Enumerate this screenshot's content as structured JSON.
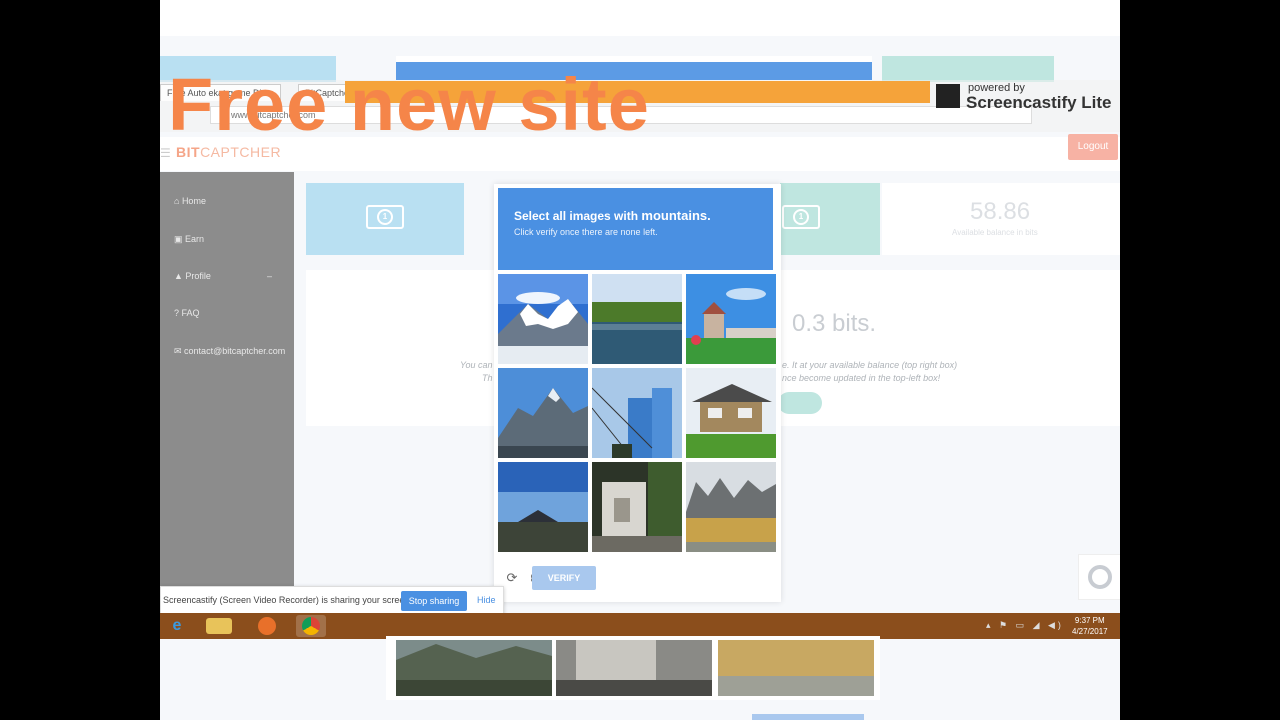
{
  "overlay": {
    "headline": "Free new site",
    "screencastify_powered": "powered by",
    "screencastify_name": "Screencastify Lite"
  },
  "browser": {
    "tabs": [
      "Free Auto ekat game Dic...",
      "BitCaptcher"
    ],
    "address": "www.bitcaptcher.com"
  },
  "site": {
    "brand_prefix": "BIT",
    "brand_suffix": "CAPTCHER",
    "logout_label": "Logout",
    "sidebar": [
      {
        "icon": "home-icon",
        "label": "Home"
      },
      {
        "icon": "earn-icon",
        "label": "Earn"
      },
      {
        "icon": "profile-icon",
        "label": "Profile"
      },
      {
        "icon": "faq-icon",
        "label": "FAQ"
      },
      {
        "icon": "mail-icon",
        "label": "contact@bitcaptcher.com"
      }
    ],
    "balance_value": "58.86",
    "balance_label": "Available balance in bits",
    "reward_text": "0.3 bits.",
    "info_left_1": "You can",
    "info_left_2": "Th",
    "info_right_1": "e. It at your available balance (top right box)",
    "info_right_2": "nce become updated in the top-left box!"
  },
  "captcha": {
    "title_prefix": "Select all images with",
    "title_keyword": "mountains.",
    "subtitle": "Click verify once there are none left.",
    "verify_label": "VERIFY",
    "tiles": [
      "snowy-mountain",
      "lake",
      "temple",
      "rocky-peak",
      "skyscraper",
      "house",
      "volcano-horizon",
      "stone-hut",
      "rice-field-hills"
    ]
  },
  "share_bar": {
    "text": "Screencastify (Screen Video Recorder) is sharing your screen.",
    "stop_label": "Stop sharing",
    "hide_label": "Hide"
  },
  "taskbar": {
    "time": "9:37 PM",
    "date": "4/27/2017"
  },
  "colors": {
    "accent_blue": "#4a90e2",
    "headline_orange": "#f58549",
    "taskbar_brown": "#8b4e1c"
  }
}
